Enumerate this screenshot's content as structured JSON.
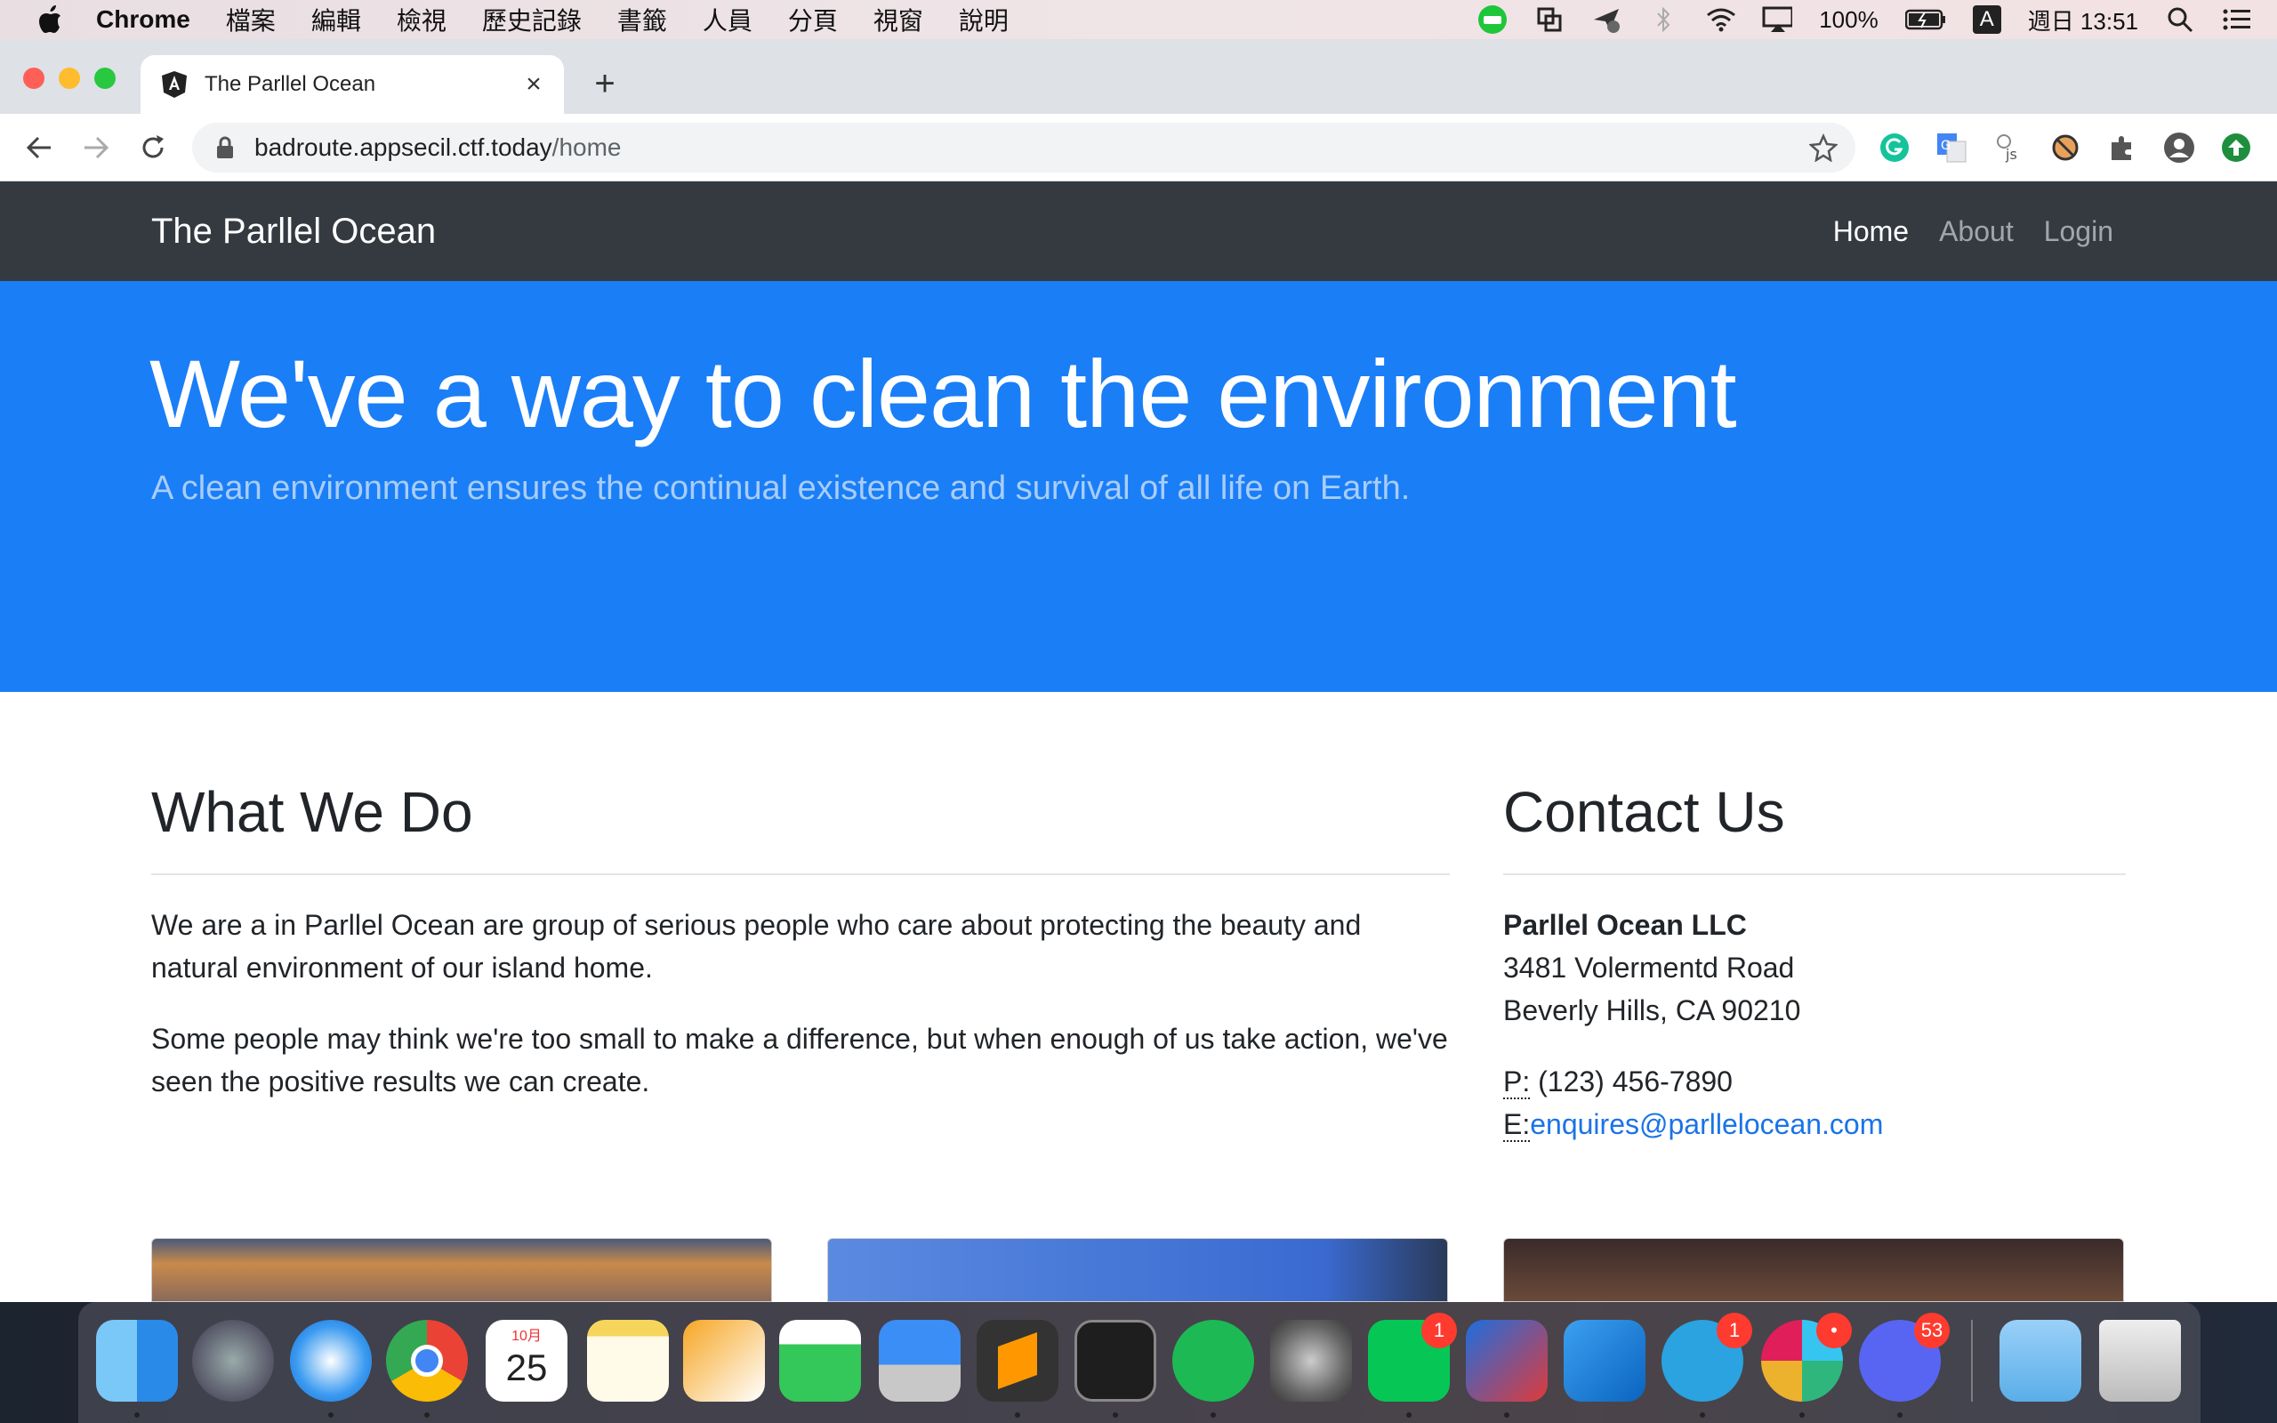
{
  "menubar": {
    "app_name": "Chrome",
    "items": [
      "檔案",
      "編輯",
      "檢視",
      "歷史記錄",
      "書籤",
      "人員",
      "分頁",
      "視窗",
      "說明"
    ],
    "battery": "100%",
    "input_source": "A",
    "clock": "週日 13:51"
  },
  "browser": {
    "tab_title": "The Parllel Ocean",
    "new_tab_symbol": "+",
    "close_symbol": "×",
    "url_host": "badroute.appsecil.ctf.today",
    "url_path": "/home"
  },
  "site": {
    "brand": "The Parllel Ocean",
    "nav": [
      {
        "label": "Home",
        "active": true
      },
      {
        "label": "About",
        "active": false
      },
      {
        "label": "Login",
        "active": false
      }
    ],
    "hero": {
      "heading": "We've a way to clean the environment",
      "lead": "A clean environment ensures the continual existence and survival of all life on Earth."
    },
    "what_we_do": {
      "heading": "What We Do",
      "paragraphs": [
        "We are a in Parllel Ocean are group of serious people who care about protecting the beauty and natural environment of our island home.",
        "Some people may think we're too small to make a difference, but when enough of us take action, we've seen the positive results we can create."
      ]
    },
    "contact": {
      "heading": "Contact Us",
      "company": "Parllel Ocean LLC",
      "street": "3481 Volermentd Road",
      "city": "Beverly Hills, CA 90210",
      "phone_label": "P:",
      "phone": " (123) 456-7890",
      "email_label": "E:",
      "email": "enquires@parllelocean.com"
    }
  },
  "dock": {
    "calendar_month": "10月",
    "calendar_day": "25",
    "badges": {
      "line": "1",
      "telegram": "1",
      "slack": "•",
      "discord": "53"
    },
    "icons": [
      "finder-icon",
      "launchpad-icon",
      "safari-icon",
      "chrome-icon",
      "calendar-icon",
      "notes-icon",
      "pages-icon",
      "numbers-icon",
      "keynote-icon",
      "sublime-text-icon",
      "terminal-icon",
      "spotify-icon",
      "system-preferences-icon",
      "line-icon",
      "vmware-icon",
      "vscode-icon",
      "telegram-icon",
      "slack-icon",
      "discord-icon",
      "downloads-folder-icon",
      "trash-icon"
    ]
  },
  "colors": {
    "navbar": "#343a40",
    "hero": "#1a7ef7",
    "link": "#1a73e8"
  }
}
